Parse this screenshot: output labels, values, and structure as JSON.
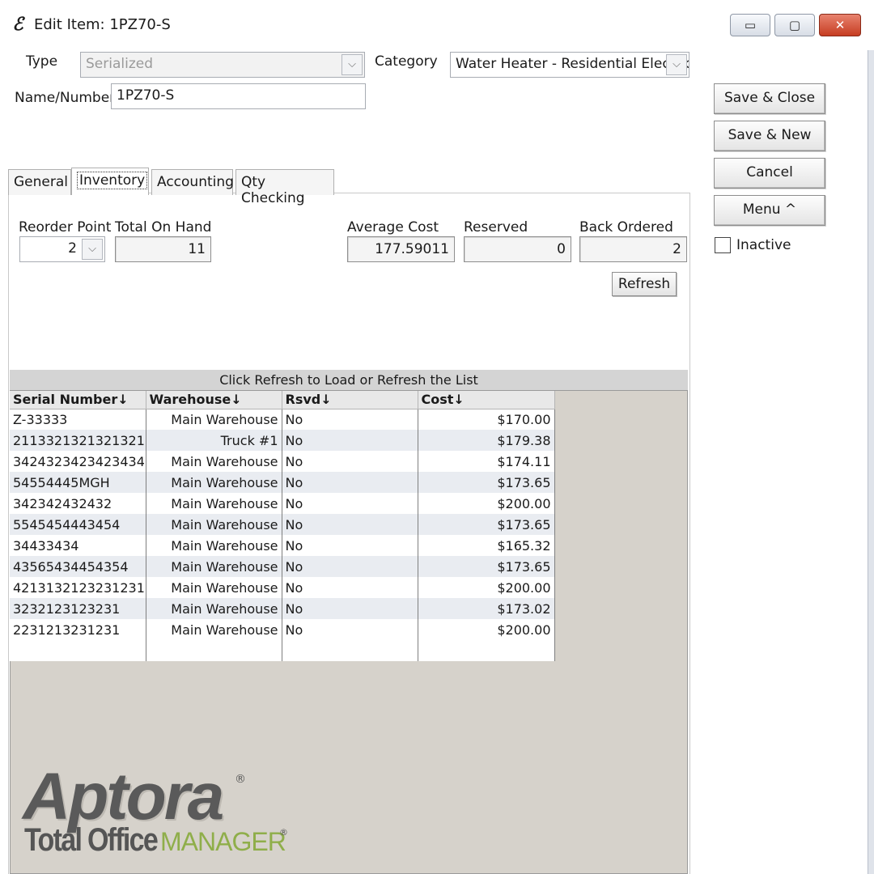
{
  "window": {
    "title": "Edit Item: 1PZ70-S",
    "app_icon": "aptora-e-icon",
    "controls": {
      "minimize": "▭",
      "maximize": "▢",
      "close": "✕"
    }
  },
  "header": {
    "type_label": "Type",
    "type_value": "Serialized",
    "category_label": "Category",
    "category_value": "Water Heater - Residential Electric",
    "name_label": "Name/Number",
    "name_value": "1PZ70-S"
  },
  "actions": {
    "save_close": "Save & Close",
    "save_new": "Save & New",
    "cancel": "Cancel",
    "menu": "Menu ^",
    "inactive_label": "Inactive"
  },
  "tabs": [
    "General",
    "Inventory",
    "Accounting",
    "Qty Checking"
  ],
  "inventory": {
    "reorder_point_label": "Reorder Point",
    "reorder_point_value": "2",
    "total_on_hand_label": "Total On Hand",
    "total_on_hand_value": "11",
    "average_cost_label": "Average Cost",
    "average_cost_value": "177.59011",
    "reserved_label": "Reserved",
    "reserved_value": "0",
    "back_ordered_label": "Back Ordered",
    "back_ordered_value": "2",
    "refresh_label": "Refresh"
  },
  "grid": {
    "caption": "Click Refresh to Load or Refresh the List",
    "columns": [
      "Serial Number↓",
      "Warehouse↓",
      "Rsvd↓",
      "Cost↓"
    ],
    "rows": [
      [
        "Z-33333",
        "Main Warehouse",
        "No",
        "$170.00"
      ],
      [
        "2113321321321321",
        "Truck #1",
        "No",
        "$179.38"
      ],
      [
        "3424323423423434",
        "Main Warehouse",
        "No",
        "$174.11"
      ],
      [
        "54554445MGH",
        "Main Warehouse",
        "No",
        "$173.65"
      ],
      [
        "342342432432",
        "Main Warehouse",
        "No",
        "$200.00"
      ],
      [
        "5545454443454",
        "Main Warehouse",
        "No",
        "$173.65"
      ],
      [
        "34433434",
        "Main Warehouse",
        "No",
        "$165.32"
      ],
      [
        "43565434454354",
        "Main Warehouse",
        "No",
        "$173.65"
      ],
      [
        "4213132123231231",
        "Main Warehouse",
        "No",
        "$200.00"
      ],
      [
        "3232123123231",
        "Main Warehouse",
        "No",
        "$173.02"
      ],
      [
        "2231213231231",
        "Main Warehouse",
        "No",
        "$200.00"
      ]
    ]
  },
  "logo": {
    "brand": "Aptora",
    "reg": "®",
    "product_bold": "Total Office",
    "product_light": "MANAGER",
    "product_reg": "®"
  }
}
